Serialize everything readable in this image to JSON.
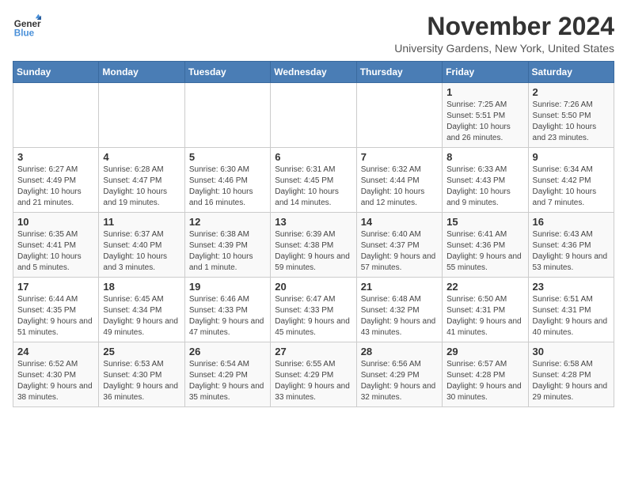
{
  "logo": {
    "general": "General",
    "blue": "Blue"
  },
  "title": "November 2024",
  "subtitle": "University Gardens, New York, United States",
  "days_of_week": [
    "Sunday",
    "Monday",
    "Tuesday",
    "Wednesday",
    "Thursday",
    "Friday",
    "Saturday"
  ],
  "weeks": [
    [
      {
        "day": "",
        "info": ""
      },
      {
        "day": "",
        "info": ""
      },
      {
        "day": "",
        "info": ""
      },
      {
        "day": "",
        "info": ""
      },
      {
        "day": "",
        "info": ""
      },
      {
        "day": "1",
        "info": "Sunrise: 7:25 AM\nSunset: 5:51 PM\nDaylight: 10 hours and 26 minutes."
      },
      {
        "day": "2",
        "info": "Sunrise: 7:26 AM\nSunset: 5:50 PM\nDaylight: 10 hours and 23 minutes."
      }
    ],
    [
      {
        "day": "3",
        "info": "Sunrise: 6:27 AM\nSunset: 4:49 PM\nDaylight: 10 hours and 21 minutes."
      },
      {
        "day": "4",
        "info": "Sunrise: 6:28 AM\nSunset: 4:47 PM\nDaylight: 10 hours and 19 minutes."
      },
      {
        "day": "5",
        "info": "Sunrise: 6:30 AM\nSunset: 4:46 PM\nDaylight: 10 hours and 16 minutes."
      },
      {
        "day": "6",
        "info": "Sunrise: 6:31 AM\nSunset: 4:45 PM\nDaylight: 10 hours and 14 minutes."
      },
      {
        "day": "7",
        "info": "Sunrise: 6:32 AM\nSunset: 4:44 PM\nDaylight: 10 hours and 12 minutes."
      },
      {
        "day": "8",
        "info": "Sunrise: 6:33 AM\nSunset: 4:43 PM\nDaylight: 10 hours and 9 minutes."
      },
      {
        "day": "9",
        "info": "Sunrise: 6:34 AM\nSunset: 4:42 PM\nDaylight: 10 hours and 7 minutes."
      }
    ],
    [
      {
        "day": "10",
        "info": "Sunrise: 6:35 AM\nSunset: 4:41 PM\nDaylight: 10 hours and 5 minutes."
      },
      {
        "day": "11",
        "info": "Sunrise: 6:37 AM\nSunset: 4:40 PM\nDaylight: 10 hours and 3 minutes."
      },
      {
        "day": "12",
        "info": "Sunrise: 6:38 AM\nSunset: 4:39 PM\nDaylight: 10 hours and 1 minute."
      },
      {
        "day": "13",
        "info": "Sunrise: 6:39 AM\nSunset: 4:38 PM\nDaylight: 9 hours and 59 minutes."
      },
      {
        "day": "14",
        "info": "Sunrise: 6:40 AM\nSunset: 4:37 PM\nDaylight: 9 hours and 57 minutes."
      },
      {
        "day": "15",
        "info": "Sunrise: 6:41 AM\nSunset: 4:36 PM\nDaylight: 9 hours and 55 minutes."
      },
      {
        "day": "16",
        "info": "Sunrise: 6:43 AM\nSunset: 4:36 PM\nDaylight: 9 hours and 53 minutes."
      }
    ],
    [
      {
        "day": "17",
        "info": "Sunrise: 6:44 AM\nSunset: 4:35 PM\nDaylight: 9 hours and 51 minutes."
      },
      {
        "day": "18",
        "info": "Sunrise: 6:45 AM\nSunset: 4:34 PM\nDaylight: 9 hours and 49 minutes."
      },
      {
        "day": "19",
        "info": "Sunrise: 6:46 AM\nSunset: 4:33 PM\nDaylight: 9 hours and 47 minutes."
      },
      {
        "day": "20",
        "info": "Sunrise: 6:47 AM\nSunset: 4:33 PM\nDaylight: 9 hours and 45 minutes."
      },
      {
        "day": "21",
        "info": "Sunrise: 6:48 AM\nSunset: 4:32 PM\nDaylight: 9 hours and 43 minutes."
      },
      {
        "day": "22",
        "info": "Sunrise: 6:50 AM\nSunset: 4:31 PM\nDaylight: 9 hours and 41 minutes."
      },
      {
        "day": "23",
        "info": "Sunrise: 6:51 AM\nSunset: 4:31 PM\nDaylight: 9 hours and 40 minutes."
      }
    ],
    [
      {
        "day": "24",
        "info": "Sunrise: 6:52 AM\nSunset: 4:30 PM\nDaylight: 9 hours and 38 minutes."
      },
      {
        "day": "25",
        "info": "Sunrise: 6:53 AM\nSunset: 4:30 PM\nDaylight: 9 hours and 36 minutes."
      },
      {
        "day": "26",
        "info": "Sunrise: 6:54 AM\nSunset: 4:29 PM\nDaylight: 9 hours and 35 minutes."
      },
      {
        "day": "27",
        "info": "Sunrise: 6:55 AM\nSunset: 4:29 PM\nDaylight: 9 hours and 33 minutes."
      },
      {
        "day": "28",
        "info": "Sunrise: 6:56 AM\nSunset: 4:29 PM\nDaylight: 9 hours and 32 minutes."
      },
      {
        "day": "29",
        "info": "Sunrise: 6:57 AM\nSunset: 4:28 PM\nDaylight: 9 hours and 30 minutes."
      },
      {
        "day": "30",
        "info": "Sunrise: 6:58 AM\nSunset: 4:28 PM\nDaylight: 9 hours and 29 minutes."
      }
    ]
  ]
}
